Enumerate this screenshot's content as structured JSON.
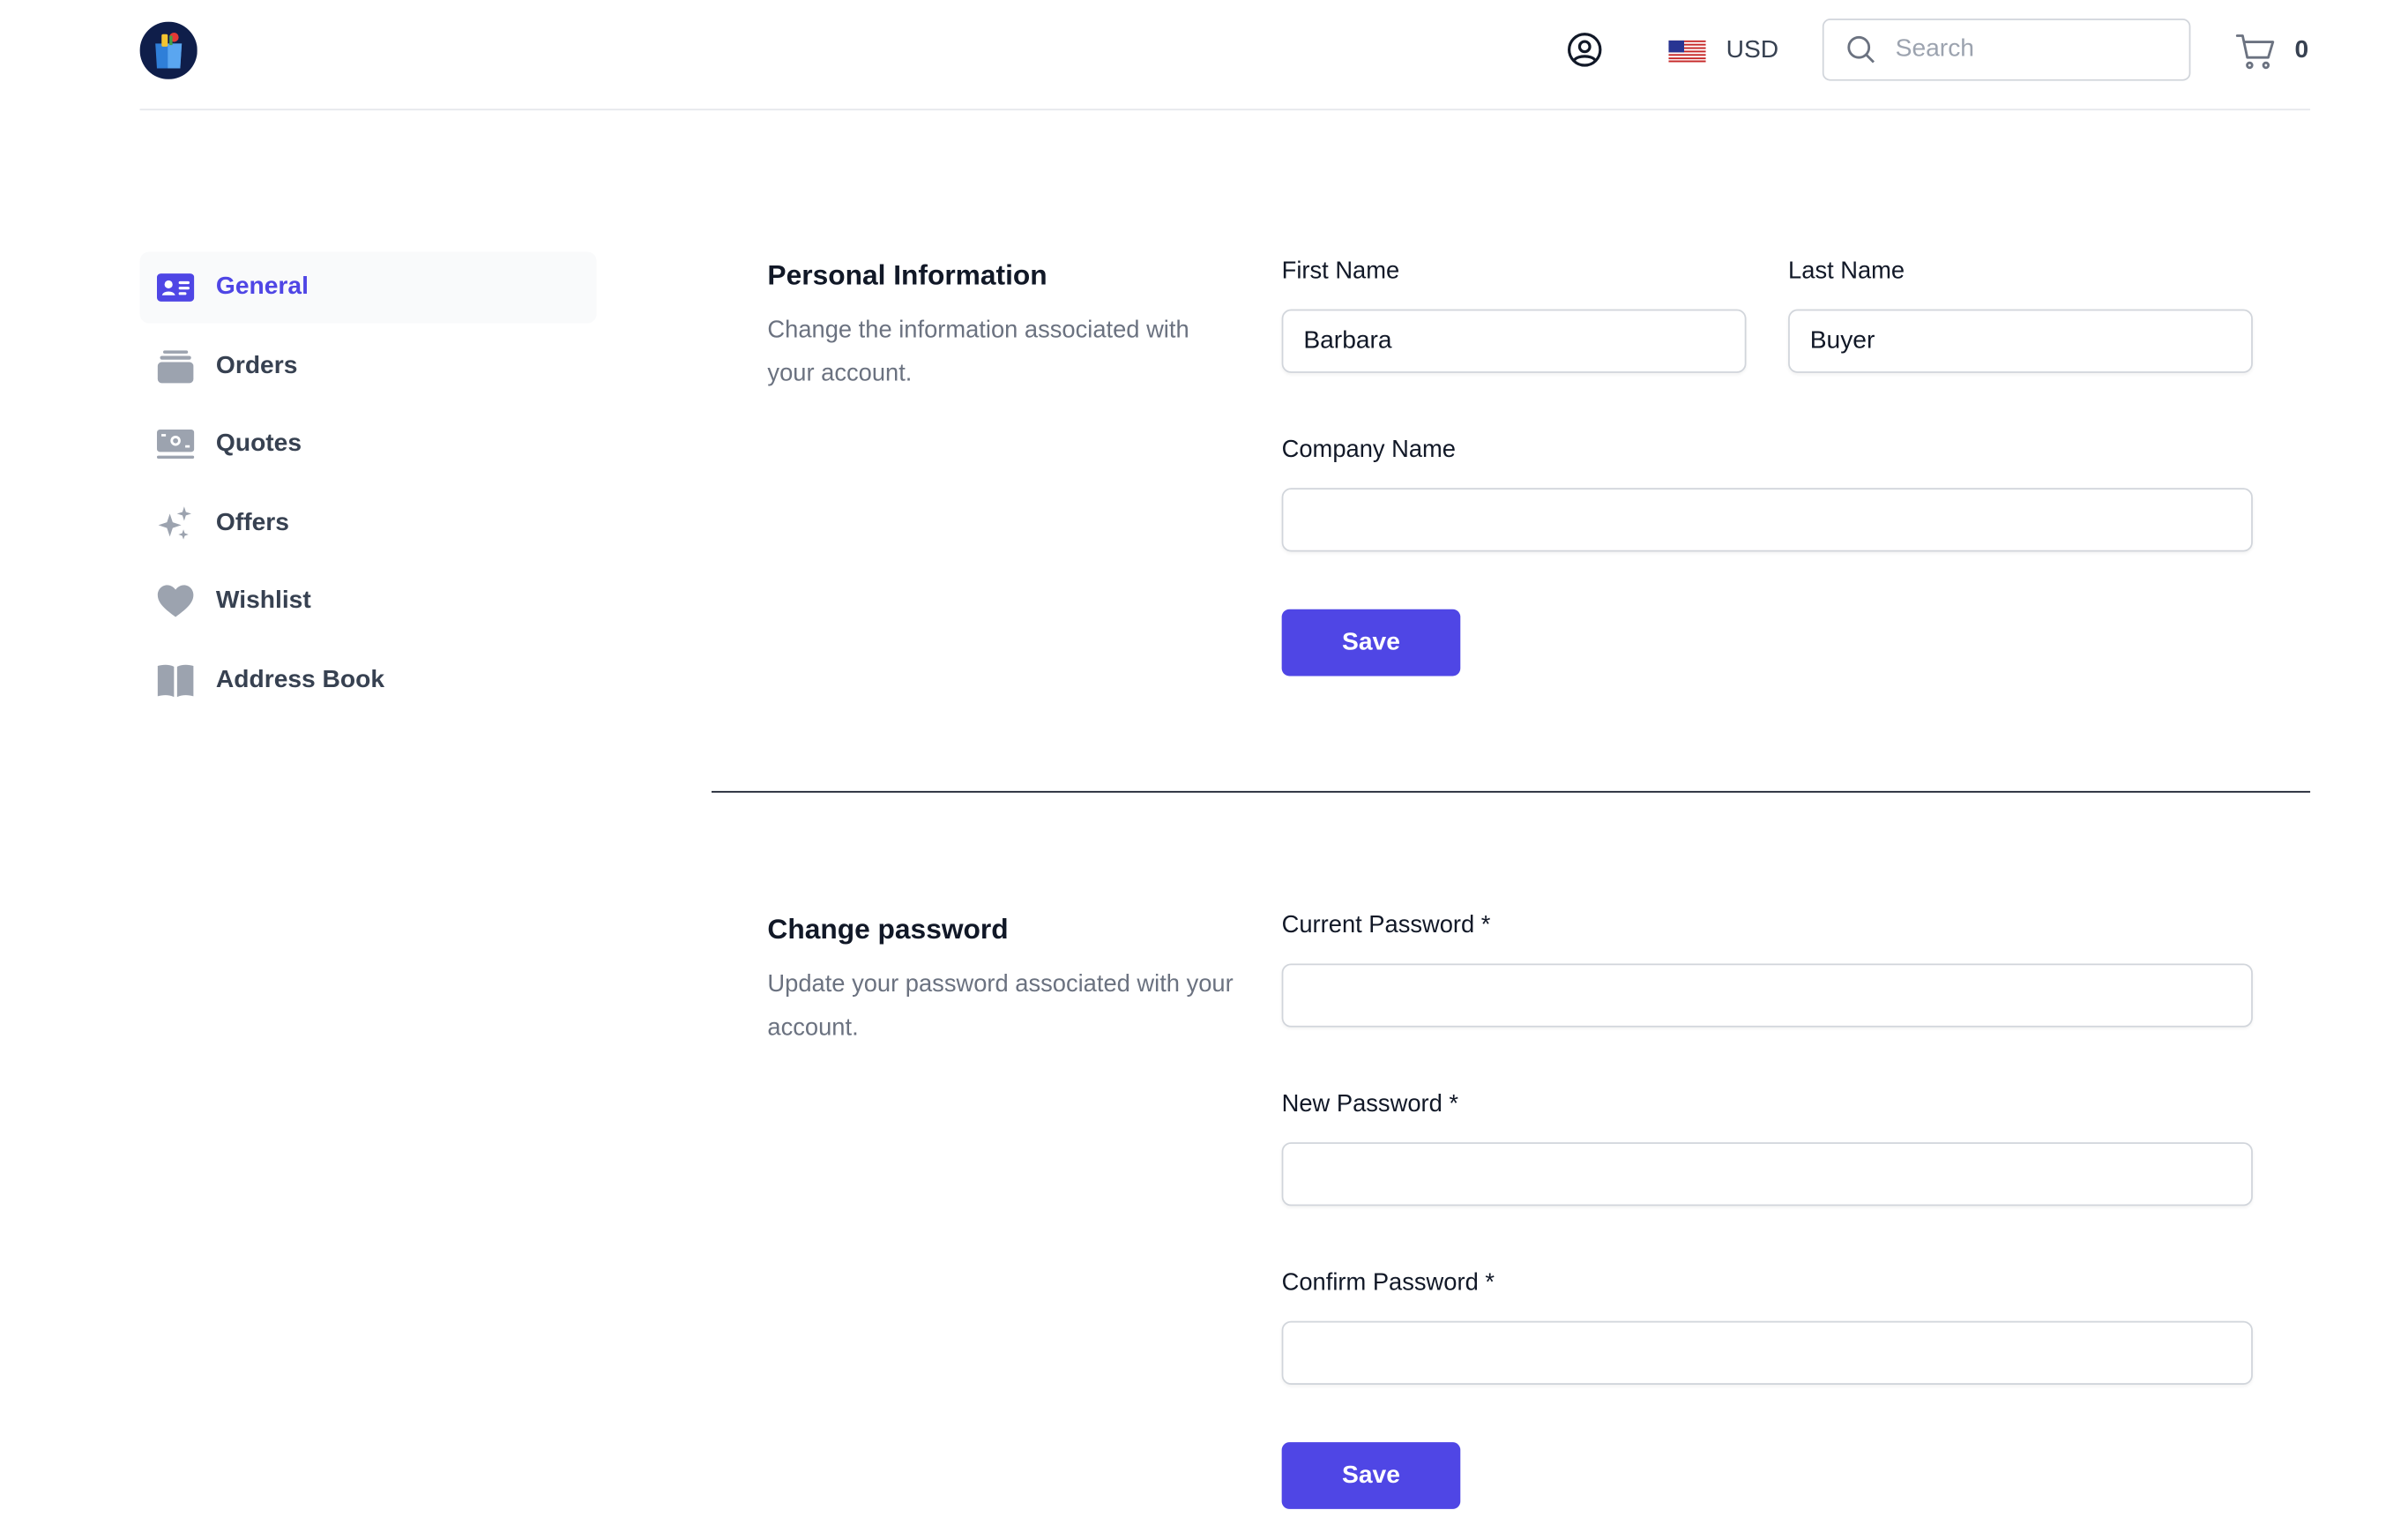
{
  "header": {
    "currency": "USD",
    "search_placeholder": "Search",
    "cart_count": "0"
  },
  "sidebar": {
    "items": [
      {
        "label": "General",
        "icon": "id-card-icon",
        "active": true
      },
      {
        "label": "Orders",
        "icon": "stack-icon"
      },
      {
        "label": "Quotes",
        "icon": "banknote-icon"
      },
      {
        "label": "Offers",
        "icon": "sparkles-icon"
      },
      {
        "label": "Wishlist",
        "icon": "heart-icon"
      },
      {
        "label": "Address Book",
        "icon": "book-icon"
      }
    ]
  },
  "personal": {
    "title": "Personal Information",
    "description": "Change the information associated with your account.",
    "first_name_label": "First Name",
    "first_name_value": "Barbara",
    "last_name_label": "Last Name",
    "last_name_value": "Buyer",
    "company_label": "Company Name",
    "company_value": "",
    "save_label": "Save"
  },
  "password": {
    "title": "Change password",
    "description": "Update your password associated with your account.",
    "current_label": "Current Password *",
    "new_label": "New Password *",
    "confirm_label": "Confirm Password *",
    "save_label": "Save"
  },
  "colors": {
    "accent": "#4f46e5",
    "nav_active_bg": "#f9fafb",
    "icon_gray": "#9ca3af"
  }
}
